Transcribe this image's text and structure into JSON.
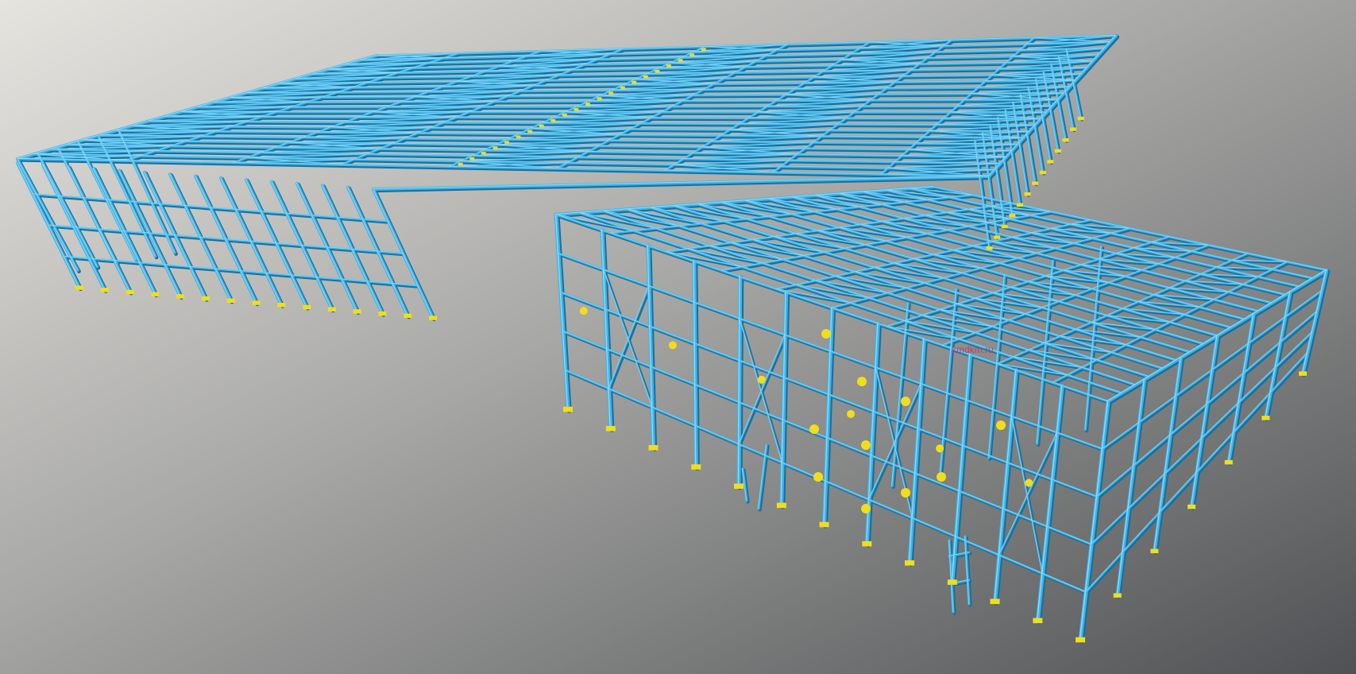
{
  "scene": {
    "subject": "3d-steel-frame-structure",
    "background_colors": [
      "#e4e2dd",
      "#a6a6a4",
      "#55585a"
    ],
    "steel_color": "#3fb4e6",
    "steel_highlight_color": "#8fd8f7",
    "steel_shadow_color": "#1c6f9c",
    "connection_color": "#f2dd1c"
  },
  "watermark": {
    "text": "kmdkm.ru"
  }
}
